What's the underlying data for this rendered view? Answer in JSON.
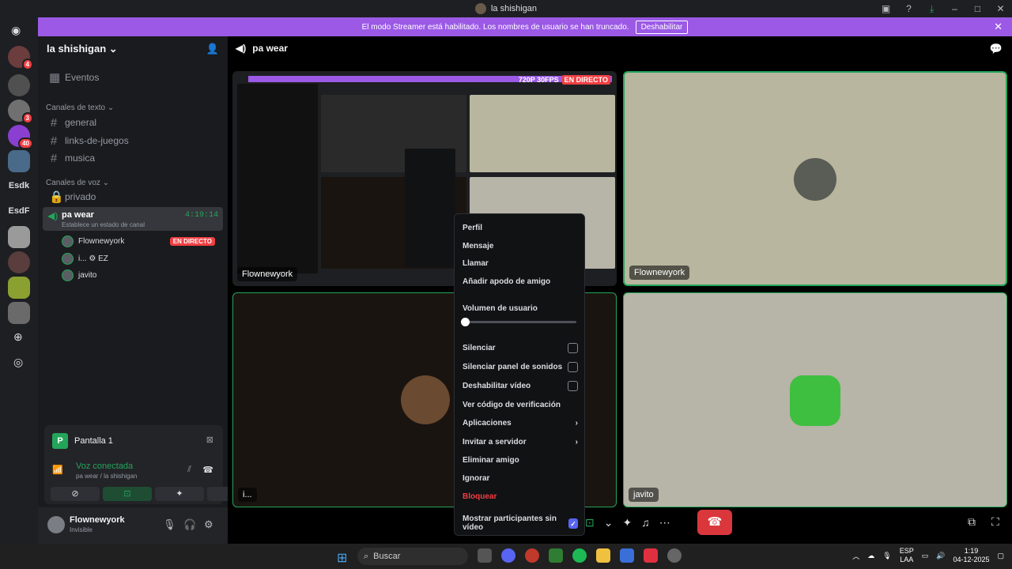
{
  "window": {
    "title": "la shishigan"
  },
  "banner": {
    "text": "El modo Streamer está habilitado. Los nombres de usuario se han truncado.",
    "button": "Deshabilitar"
  },
  "guilds": {
    "badges": [
      "4",
      "3",
      "40"
    ],
    "text_items": [
      "Esdk",
      "EsdF"
    ]
  },
  "server": {
    "name": "la shishigan",
    "events": "Eventos",
    "text_category": "Canales de texto",
    "text_channels": [
      "general",
      "links-de-juegos",
      "musica"
    ],
    "voice_category": "Canales de voz",
    "voice_channels": [
      "privado"
    ],
    "active_voice": {
      "name": "pa wear",
      "time": "4:19:14",
      "status": "Establece un estado de canal"
    },
    "voice_users": [
      {
        "name": "Flownewyork",
        "live": "EN DIRECTO"
      },
      {
        "name": "i... ⚙ EZ"
      },
      {
        "name": "javito"
      }
    ]
  },
  "panel": {
    "screen_title": "Pantalla 1",
    "voice_connected": "Voz conectada",
    "voice_location": "pa wear / la shishigan"
  },
  "user": {
    "name": "Flownewyork",
    "status": "Invisible"
  },
  "stage": {
    "channel": "pa wear",
    "tiles": [
      {
        "label": "Flownewyork",
        "quality": "720P 30FPS",
        "live": "EN DIRECTO"
      },
      {
        "label": "Flownewyork"
      },
      {
        "label": "i..."
      },
      {
        "label": "javito"
      }
    ]
  },
  "context_menu": {
    "items": [
      "Perfil",
      "Mensaje",
      "Llamar",
      "Añadir apodo de amigo"
    ],
    "volume_label": "Volumen de usuario",
    "volume_level": 0,
    "toggles": [
      {
        "label": "Silenciar",
        "checked": false
      },
      {
        "label": "Silenciar panel de sonidos",
        "checked": false
      },
      {
        "label": "Deshabilitar vídeo",
        "checked": false
      }
    ],
    "actions": [
      "Ver código de verificación",
      "Aplicaciones",
      "Invitar a servidor",
      "Eliminar amigo",
      "Ignorar"
    ],
    "danger": "Bloquear",
    "footer": {
      "label": "Mostrar participantes sin vídeo",
      "checked": true
    }
  },
  "taskbar": {
    "search": "Buscar",
    "lang": "ESP",
    "lang2": "LAA",
    "time": "1:19",
    "date": "04-12-2025"
  }
}
